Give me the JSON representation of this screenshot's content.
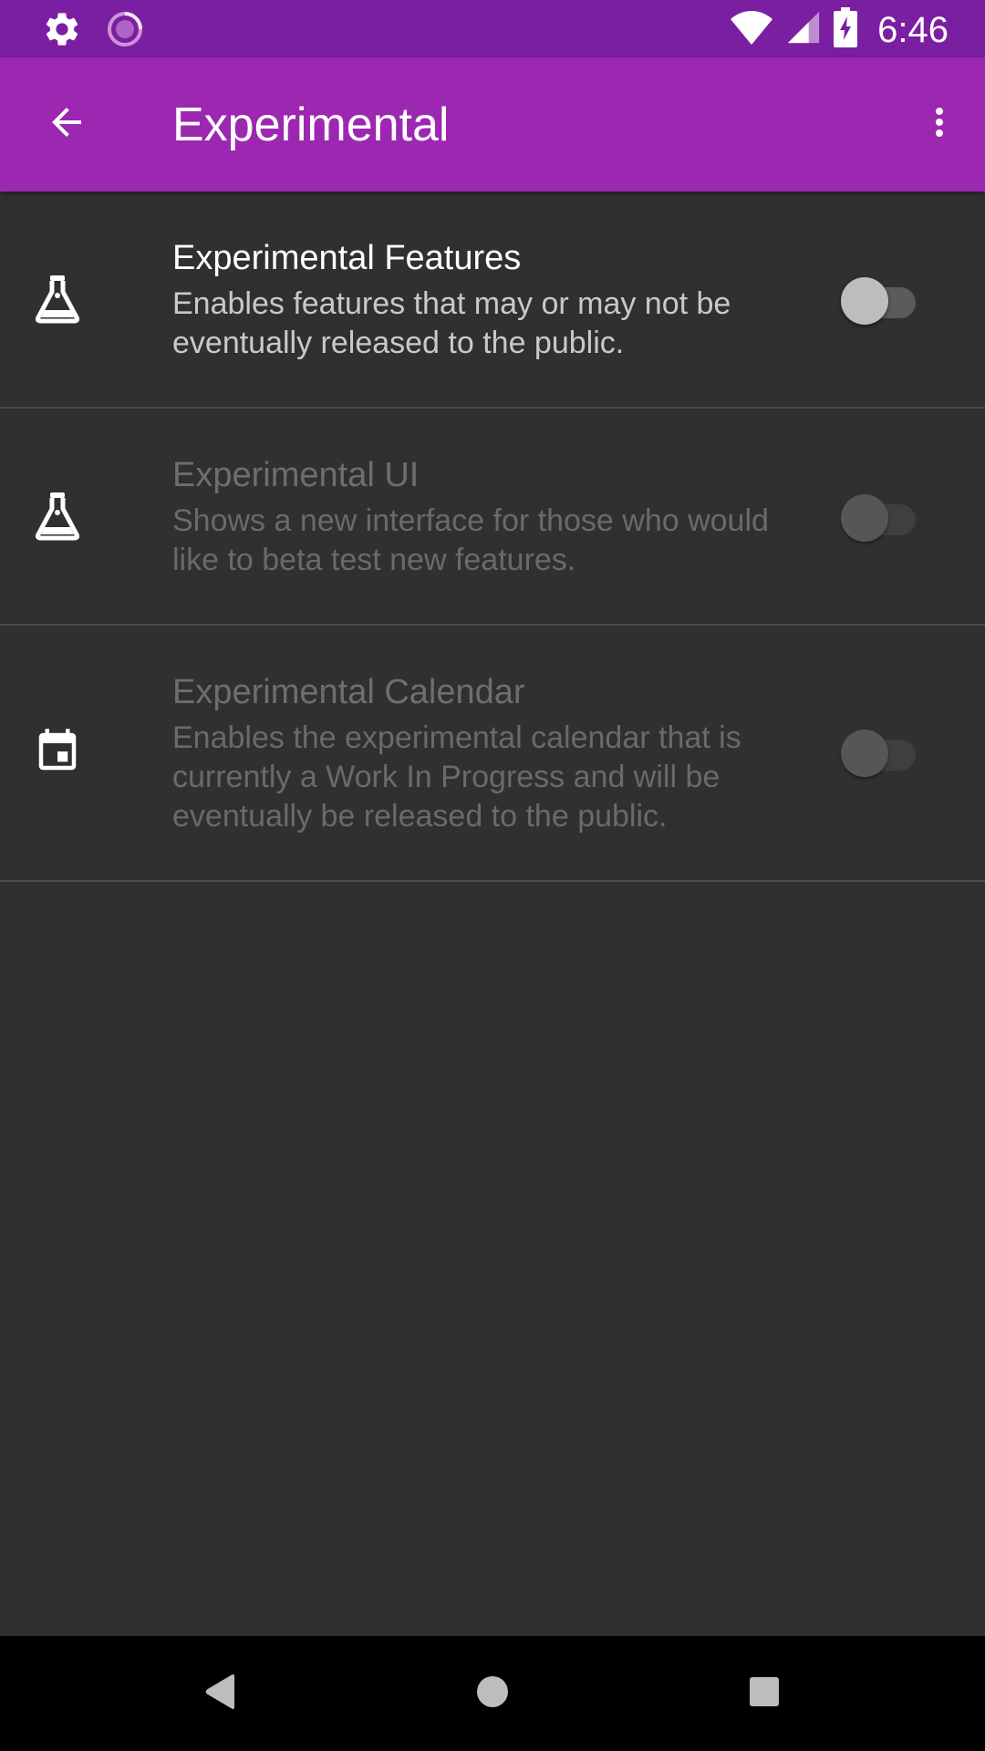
{
  "status_bar": {
    "time": "6:46",
    "left_icons": [
      "gear-icon",
      "sync-progress-icon"
    ],
    "right_icons": [
      "wifi-icon",
      "cell-signal-icon",
      "battery-charging-icon"
    ]
  },
  "app_bar": {
    "title": "Experimental",
    "back_icon": "arrow-back-icon",
    "overflow_icon": "more-vert-icon"
  },
  "preferences": [
    {
      "icon": "flask-icon",
      "title": "Experimental Features",
      "summary": "Enables features that may or may not be eventually released to the public.",
      "enabled": true,
      "checked": false
    },
    {
      "icon": "flask-icon",
      "title": "Experimental UI",
      "summary": "Shows a new interface for those who would like to beta test new features.",
      "enabled": false,
      "checked": false
    },
    {
      "icon": "calendar-icon",
      "title": "Experimental Calendar",
      "summary": "Enables the experimental calendar that is currently a Work In Progress and will be eventually be released to the public.",
      "enabled": false,
      "checked": false
    }
  ],
  "nav_bar": {
    "buttons": [
      "back-triangle-icon",
      "home-circle-icon",
      "recents-square-icon"
    ]
  },
  "colors": {
    "status_bar": "#7b1fa2",
    "app_bar": "#9c27b0",
    "background": "#303030",
    "divider": "#4a4a4a"
  }
}
